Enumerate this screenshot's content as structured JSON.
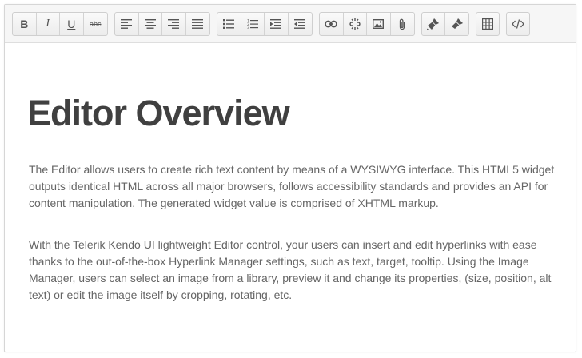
{
  "toolbar": {
    "groups": [
      [
        "bold",
        "italic",
        "underline",
        "strikethrough"
      ],
      [
        "justify-left",
        "justify-center",
        "justify-right",
        "justify-full"
      ],
      [
        "unordered-list",
        "ordered-list",
        "indent",
        "outdent"
      ],
      [
        "create-link",
        "unlink",
        "insert-image",
        "insert-file"
      ],
      [
        "clean-formatting",
        "format-painter"
      ],
      [
        "table"
      ],
      [
        "view-html"
      ]
    ],
    "bold_label": "B",
    "italic_label": "I",
    "underline_label": "U",
    "strikethrough_label": "abc"
  },
  "content": {
    "title": "Editor Overview",
    "paragraphs": [
      "The Editor allows users to create rich text content by means of a WYSIWYG interface. This HTML5 widget outputs identical HTML across all major browsers, follows accessibility standards and provides an API for content manipulation. The generated widget value is comprised of XHTML markup.",
      "With the Telerik Kendo UI lightweight Editor control, your users can insert and edit hyperlinks with ease thanks to the out-of-the-box Hyperlink Manager settings, such as text, target, tooltip. Using the Image Manager, users can select an image from a library, preview it and change its properties, (size, position, alt text) or edit the image itself by cropping, rotating, etc."
    ]
  },
  "colors": {
    "toolbar_bg": "#f6f6f6",
    "border": "#d6d6d6",
    "title": "#404040",
    "text": "#656565",
    "icon": "#555555"
  }
}
